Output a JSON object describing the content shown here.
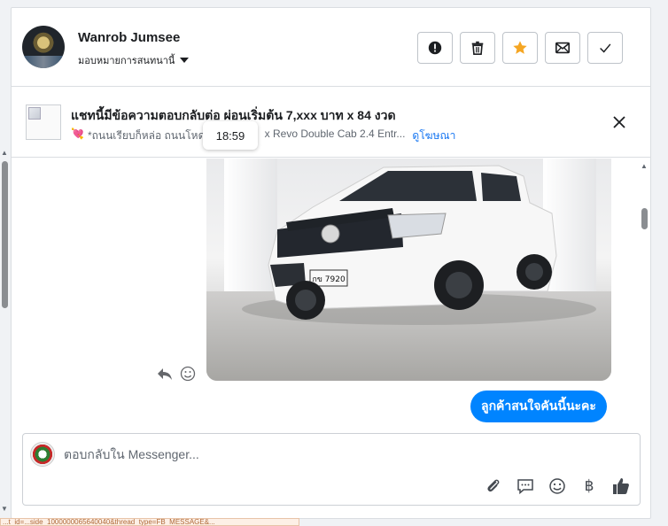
{
  "header": {
    "user_name": "Wanrob Jumsee",
    "assign_label": "มอบหมายการสนทนานี้",
    "buttons": [
      "report-icon",
      "trash-icon",
      "star-icon",
      "envelope-icon",
      "check-icon"
    ],
    "star_color": "#f5a623"
  },
  "ad": {
    "title": "แชทนี้มีข้อความตอบกลับต่อ ผ่อนเริ่มต้น 7,xxx บาท x 84 งวด",
    "subtitle": "*ถนนเรียบก็หล่อ ถนนโหดก็",
    "subtitle_tail": "x Revo Double Cab 2.4 Entr...",
    "link": "ดูโฆษณา",
    "tooltip_time": "18:59"
  },
  "chat": {
    "image": {
      "alt": "car-photo",
      "plate": "กข 7920"
    },
    "reply_message": "ลูกค้าสนใจคันนี้นะคะ",
    "bubble_color": "#0084ff"
  },
  "composer": {
    "placeholder": "ตอบกลับใน Messenger...",
    "icons": [
      "paperclip-icon",
      "speech-bubble-icon",
      "smiley-icon",
      "baht-icon",
      "thumbs-up-icon"
    ],
    "baht_symbol": "฿"
  },
  "status_bar": {
    "url": "...t_id=...side_1000000065640040&thread_type=FB_MESSAGE&..."
  }
}
